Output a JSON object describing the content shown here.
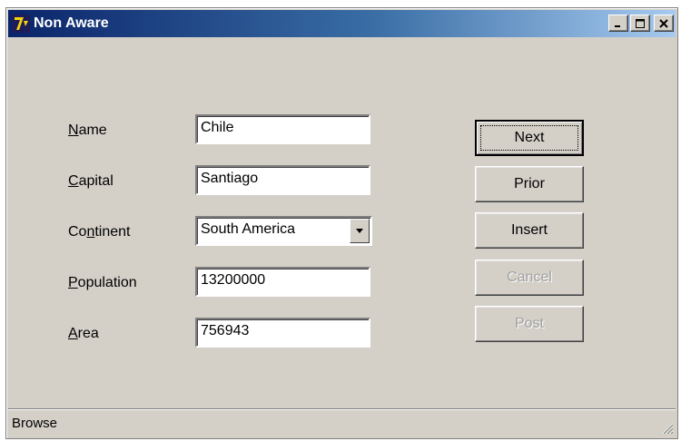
{
  "window": {
    "title": "Non Aware",
    "buttons": {
      "minimize": "_",
      "maximize": "□",
      "close": "×"
    }
  },
  "form": {
    "fields": [
      {
        "label_first": "N",
        "label_rest": "ame",
        "value": "Chile"
      },
      {
        "label_first": "C",
        "label_rest": "apital",
        "value": "Santiago"
      },
      {
        "label_first": "Co",
        "label_mid": "n",
        "label_rest": "tinent",
        "value": "South America"
      },
      {
        "label_first": "P",
        "label_rest": "opulation",
        "value": "13200000"
      },
      {
        "label_first": "A",
        "label_rest": "rea",
        "value": "756943"
      }
    ]
  },
  "buttons": {
    "next": "Next",
    "prior": "Prior",
    "insert": "Insert",
    "cancel": "Cancel",
    "post": "Post"
  },
  "statusbar": {
    "text": "Browse"
  },
  "icons": {
    "app": "delphi-app-icon",
    "dropdown": "chevron-down-icon",
    "grip": "resize-grip-icon"
  },
  "colors": {
    "titlebar_start": "#0a246a",
    "titlebar_end": "#a6caf0",
    "face": "#d4d0c8"
  }
}
